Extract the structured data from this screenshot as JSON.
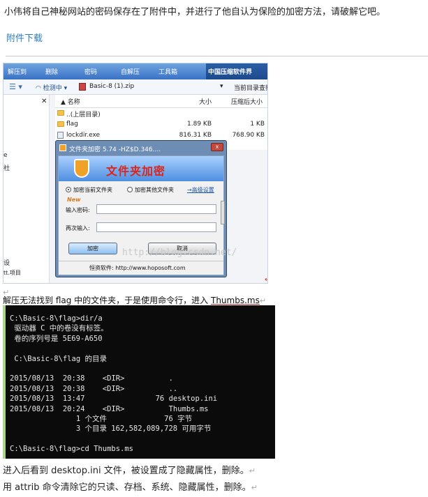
{
  "intro": "小伟将自己神秘网站的密码保存在了附件中，并进行了他自认为保险的加密方法，请破解它吧。",
  "download_link": "附件下载",
  "screenshot1": {
    "toolbar": [
      "解压到",
      "删除",
      "密码",
      "自解压",
      "工具箱"
    ],
    "brand": "中国压缩软件界",
    "addr_status": "检测中",
    "archive_name": "Basic-8 (1).zip",
    "search_label": "当前目录查找",
    "col_name": "名称",
    "col_size": "大小",
    "col_csize": "压缩后大小",
    "files": [
      {
        "name": "..(上层目录)",
        "size": "",
        "csize": "",
        "kind": "folder"
      },
      {
        "name": "flag",
        "size": "1.89 KB",
        "csize": "1 KB",
        "kind": "folder"
      },
      {
        "name": "lockdir.exe",
        "size": "816.31 KB",
        "csize": "768.90 KB",
        "kind": "exe"
      }
    ],
    "left_fragments": [
      "e",
      "社",
      "设",
      "tt.项目"
    ],
    "dialog": {
      "title": "文件夹加密 5.74 -HZ$D.346....",
      "close": "x",
      "banner": "文件夹加密",
      "opt_current": "加密当前文件夹",
      "opt_other": "加密其他文件夹",
      "advanced": "→高级设置",
      "new_badge": "New",
      "pwd_label": "输入密码:",
      "pwd_value": "",
      "confirm_label": "再次输入:",
      "encrypt_btn": "加密",
      "cancel_btn": "取消",
      "footer": "恒资软件: http://www.hoposoft.com"
    },
    "watermark": "http://blog.csdn.net/"
  },
  "caption": {
    "pre": "解压无法找到 flag 中的文件夹，于是使用命令行，进入 ",
    "target": "Thumbs.ms"
  },
  "terminal": {
    "lines": [
      "C:\\Basic-8\\flag>dir/a",
      " 驱动器 C 中的卷没有标签。",
      " 卷的序列号是 5E69-A650",
      "",
      " C:\\Basic-8\\flag 的目录",
      "",
      "2015/08/13  20:38    <DIR>          .",
      "2015/08/13  20:38    <DIR>          ..",
      "2015/08/13  13:47                76 desktop.ini",
      "2015/08/13  20:24    <DIR>          Thumbs.ms",
      "               1 个文件             76 字节",
      "               3 个目录 162,582,089,728 可用字节",
      "",
      "C:\\Basic-8\\flag>cd Thumbs.ms"
    ]
  },
  "para1": "进入后看到 desktop.ini 文件，被设置成了隐藏属性，删除。",
  "para2": "用 attrib 命令清除它的只读、存档、系统、隐藏属性，删除。",
  "pilcrow": "↵"
}
